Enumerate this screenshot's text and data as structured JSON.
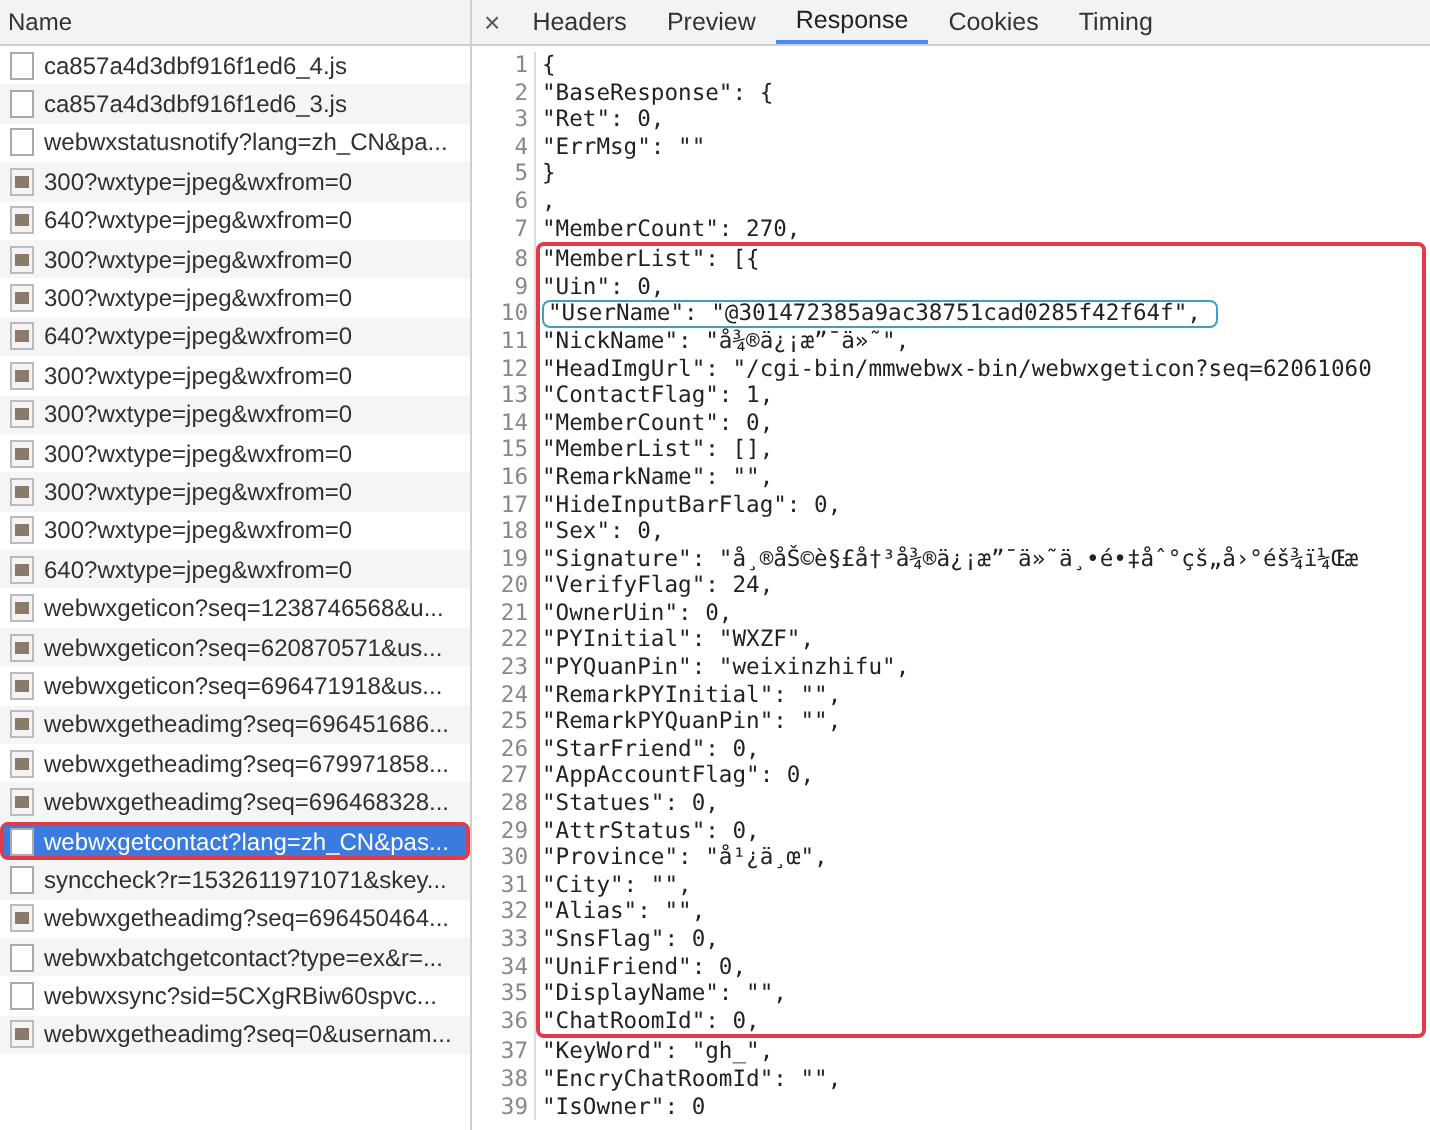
{
  "requests": {
    "column_header": "Name",
    "rows": [
      {
        "name": "ca857a4d3dbf916f1ed6_4.js",
        "kind": "file",
        "selected": false,
        "boxed": false
      },
      {
        "name": "ca857a4d3dbf916f1ed6_3.js",
        "kind": "file",
        "selected": false,
        "boxed": false
      },
      {
        "name": "webwxstatusnotify?lang=zh_CN&pa...",
        "kind": "file",
        "selected": false,
        "boxed": false
      },
      {
        "name": "300?wxtype=jpeg&wxfrom=0",
        "kind": "image",
        "selected": false,
        "boxed": false
      },
      {
        "name": "640?wxtype=jpeg&wxfrom=0",
        "kind": "image",
        "selected": false,
        "boxed": false
      },
      {
        "name": "300?wxtype=jpeg&wxfrom=0",
        "kind": "image",
        "selected": false,
        "boxed": false
      },
      {
        "name": "300?wxtype=jpeg&wxfrom=0",
        "kind": "image",
        "selected": false,
        "boxed": false
      },
      {
        "name": "640?wxtype=jpeg&wxfrom=0",
        "kind": "image",
        "selected": false,
        "boxed": false
      },
      {
        "name": "300?wxtype=jpeg&wxfrom=0",
        "kind": "image",
        "selected": false,
        "boxed": false
      },
      {
        "name": "300?wxtype=jpeg&wxfrom=0",
        "kind": "image",
        "selected": false,
        "boxed": false
      },
      {
        "name": "300?wxtype=jpeg&wxfrom=0",
        "kind": "image",
        "selected": false,
        "boxed": false
      },
      {
        "name": "300?wxtype=jpeg&wxfrom=0",
        "kind": "image",
        "selected": false,
        "boxed": false
      },
      {
        "name": "300?wxtype=jpeg&wxfrom=0",
        "kind": "image",
        "selected": false,
        "boxed": false
      },
      {
        "name": "640?wxtype=jpeg&wxfrom=0",
        "kind": "image",
        "selected": false,
        "boxed": false
      },
      {
        "name": "webwxgeticon?seq=1238746568&u...",
        "kind": "image",
        "selected": false,
        "boxed": false
      },
      {
        "name": "webwxgeticon?seq=620870571&us...",
        "kind": "image",
        "selected": false,
        "boxed": false
      },
      {
        "name": "webwxgeticon?seq=696471918&us...",
        "kind": "image",
        "selected": false,
        "boxed": false
      },
      {
        "name": "webwxgetheadimg?seq=696451686...",
        "kind": "image",
        "selected": false,
        "boxed": false
      },
      {
        "name": "webwxgetheadimg?seq=679971858...",
        "kind": "image",
        "selected": false,
        "boxed": false
      },
      {
        "name": "webwxgetheadimg?seq=696468328...",
        "kind": "image",
        "selected": false,
        "boxed": false
      },
      {
        "name": "webwxgetcontact?lang=zh_CN&pas...",
        "kind": "file",
        "selected": true,
        "boxed": true
      },
      {
        "name": "synccheck?r=1532611971071&skey...",
        "kind": "file",
        "selected": false,
        "boxed": false
      },
      {
        "name": "webwxgetheadimg?seq=696450464...",
        "kind": "image",
        "selected": false,
        "boxed": false
      },
      {
        "name": "webwxbatchgetcontact?type=ex&r=...",
        "kind": "file",
        "selected": false,
        "boxed": false
      },
      {
        "name": "webwxsync?sid=5CXgRBiw60spvc...",
        "kind": "file",
        "selected": false,
        "boxed": false
      },
      {
        "name": "webwxgetheadimg?seq=0&usernam...",
        "kind": "image",
        "selected": false,
        "boxed": false
      }
    ]
  },
  "detail": {
    "close": "×",
    "tabs": [
      {
        "label": "Headers",
        "selected": false
      },
      {
        "label": "Preview",
        "selected": false
      },
      {
        "label": "Response",
        "selected": true
      },
      {
        "label": "Cookies",
        "selected": false
      },
      {
        "label": "Timing",
        "selected": false
      }
    ],
    "blocks": [
      {
        "boxed": false,
        "lines": [
          {
            "number": "1",
            "text": "{",
            "boxed": false
          },
          {
            "number": "2",
            "text": "\"BaseResponse\": {",
            "boxed": false
          },
          {
            "number": "3",
            "text": "\"Ret\": 0,",
            "boxed": false
          },
          {
            "number": "4",
            "text": "\"ErrMsg\": \"\"",
            "boxed": false
          },
          {
            "number": "5",
            "text": "}",
            "boxed": false
          },
          {
            "number": "6",
            "text": ",",
            "boxed": false
          },
          {
            "number": "7",
            "text": "\"MemberCount\": 270,",
            "boxed": false
          }
        ]
      },
      {
        "boxed": true,
        "lines": [
          {
            "number": "8",
            "text": "\"MemberList\": [{",
            "boxed": false
          },
          {
            "number": "9",
            "text": "\"Uin\": 0,",
            "boxed": false
          },
          {
            "number": "10",
            "text": "\"UserName\": \"@301472385a9ac38751cad0285f42f64f\",",
            "boxed": true
          },
          {
            "number": "11",
            "text": "\"NickName\": \"å¾®ä¿¡æ”¯ä»˜\",",
            "boxed": false
          },
          {
            "number": "12",
            "text": "\"HeadImgUrl\": \"/cgi-bin/mmwebwx-bin/webwxgeticon?seq=62061060",
            "boxed": false
          },
          {
            "number": "13",
            "text": "\"ContactFlag\": 1,",
            "boxed": false
          },
          {
            "number": "14",
            "text": "\"MemberCount\": 0,",
            "boxed": false
          },
          {
            "number": "15",
            "text": "\"MemberList\": [],",
            "boxed": false
          },
          {
            "number": "16",
            "text": "\"RemarkName\": \"\",",
            "boxed": false
          },
          {
            "number": "17",
            "text": "\"HideInputBarFlag\": 0,",
            "boxed": false
          },
          {
            "number": "18",
            "text": "\"Sex\": 0,",
            "boxed": false
          },
          {
            "number": "19",
            "text": "\"Signature\": \"å¸®åŠ©è§£å†³å¾®ä¿¡æ”¯ä»˜ä¸•é•‡åˆ°çš„å›°éš¾ï¼Œæ",
            "boxed": false
          },
          {
            "number": "20",
            "text": "\"VerifyFlag\": 24,",
            "boxed": false
          },
          {
            "number": "21",
            "text": "\"OwnerUin\": 0,",
            "boxed": false
          },
          {
            "number": "22",
            "text": "\"PYInitial\": \"WXZF\",",
            "boxed": false
          },
          {
            "number": "23",
            "text": "\"PYQuanPin\": \"weixinzhifu\",",
            "boxed": false
          },
          {
            "number": "24",
            "text": "\"RemarkPYInitial\": \"\",",
            "boxed": false
          },
          {
            "number": "25",
            "text": "\"RemarkPYQuanPin\": \"\",",
            "boxed": false
          },
          {
            "number": "26",
            "text": "\"StarFriend\": 0,",
            "boxed": false
          },
          {
            "number": "27",
            "text": "\"AppAccountFlag\": 0,",
            "boxed": false
          },
          {
            "number": "28",
            "text": "\"Statues\": 0,",
            "boxed": false
          },
          {
            "number": "29",
            "text": "\"AttrStatus\": 0,",
            "boxed": false
          },
          {
            "number": "30",
            "text": "\"Province\": \"å¹¿ä¸œ\",",
            "boxed": false
          },
          {
            "number": "31",
            "text": "\"City\": \"\",",
            "boxed": false
          },
          {
            "number": "32",
            "text": "\"Alias\": \"\",",
            "boxed": false
          },
          {
            "number": "33",
            "text": "\"SnsFlag\": 0,",
            "boxed": false
          },
          {
            "number": "34",
            "text": "\"UniFriend\": 0,",
            "boxed": false
          },
          {
            "number": "35",
            "text": "\"DisplayName\": \"\",",
            "boxed": false
          },
          {
            "number": "36",
            "text": "\"ChatRoomId\": 0,",
            "boxed": false
          }
        ]
      },
      {
        "boxed": false,
        "lines": [
          {
            "number": "37",
            "text": "\"KeyWord\": \"gh_\",",
            "boxed": false
          },
          {
            "number": "38",
            "text": "\"EncryChatRoomId\": \"\",",
            "boxed": false
          },
          {
            "number": "39",
            "text": "\"IsOwner\": 0",
            "boxed": false
          }
        ]
      }
    ]
  }
}
